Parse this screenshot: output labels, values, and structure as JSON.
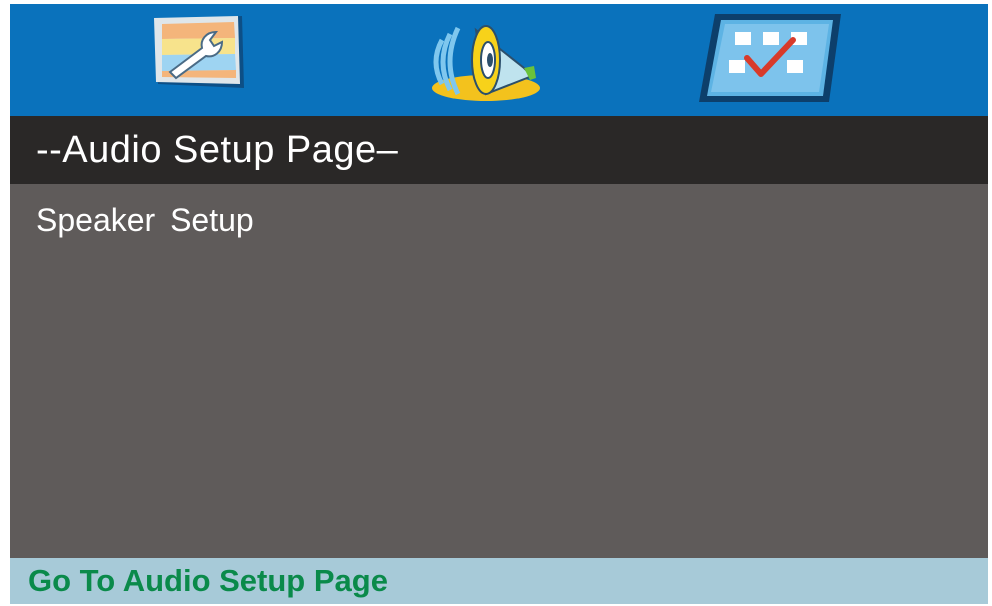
{
  "tabs": [
    {
      "id": "general-setup",
      "icon": "wrench-icon",
      "selected": false
    },
    {
      "id": "audio-setup",
      "icon": "speaker-icon",
      "selected": true
    },
    {
      "id": "preference",
      "icon": "checklist-icon",
      "selected": false
    }
  ],
  "page": {
    "title": "--Audio Setup Page–"
  },
  "menu": {
    "items": [
      {
        "label": "Speaker  Setup"
      }
    ]
  },
  "status": {
    "text": "Go To Audio Setup Page"
  },
  "colors": {
    "tab_bar": "#0a72bc",
    "title_bar": "#2a2827",
    "content_bg": "#5f5b5a",
    "status_bg": "#a7cad8",
    "status_text": "#0a8a4a"
  }
}
